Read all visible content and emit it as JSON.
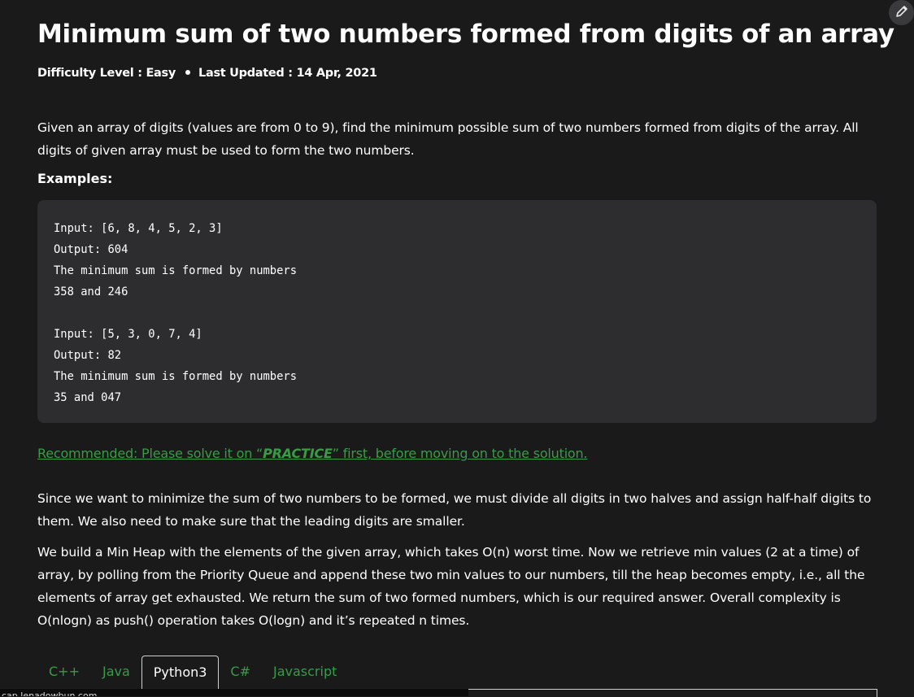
{
  "article": {
    "title": "Minimum sum of two numbers formed from digits of an array",
    "difficulty": "Difficulty Level : Easy",
    "last_updated": "Last Updated : 14 Apr, 2021",
    "intro": "Given an array of digits (values are from 0 to 9), find the minimum possible sum of two numbers formed from digits of the array. All digits of given array must be used to form the two numbers.",
    "examples_heading": "Examples:",
    "code_lines": [
      "Input: [6, 8, 4, 5, 2, 3]",
      "Output: 604",
      "The minimum sum is formed by numbers",
      "358 and 246",
      "",
      "Input: [5, 3, 0, 7, 4]",
      "Output: 82",
      "The minimum sum is formed by numbers",
      "35 and 047"
    ],
    "recommended_prefix": "Recommended: Please solve it on “",
    "recommended_practice": "PRACTICE",
    "recommended_suffix": "” first, before moving on to the solution.",
    "para2": "Since we want to minimize the sum of two numbers to be formed, we must divide all digits in two halves and assign half-half digits to them. We also need to make sure that the leading digits are smaller.",
    "para3": "We build a Min Heap with the elements of the given array, which takes O(n) worst time. Now we retrieve min values (2 at a time) of array, by polling from the Priority Queue and append these two min values to our numbers, till the heap becomes empty, i.e., all the elements of array get exhausted. We return the sum of two formed numbers, which is our required answer. Overall complexity is O(nlogn) as push() operation takes O(logn) and it’s repeated n times."
  },
  "tabs": [
    "C++",
    "Java",
    "Python3",
    "C#",
    "Javascript"
  ],
  "active_tab": "Python3",
  "status_url": "cap.lenadowbun.com",
  "colors": {
    "background": "#1a1a1b",
    "code_bg": "#2d2d30",
    "link_green": "#3a9b47"
  },
  "icons": {
    "edit": "pencil-icon"
  }
}
